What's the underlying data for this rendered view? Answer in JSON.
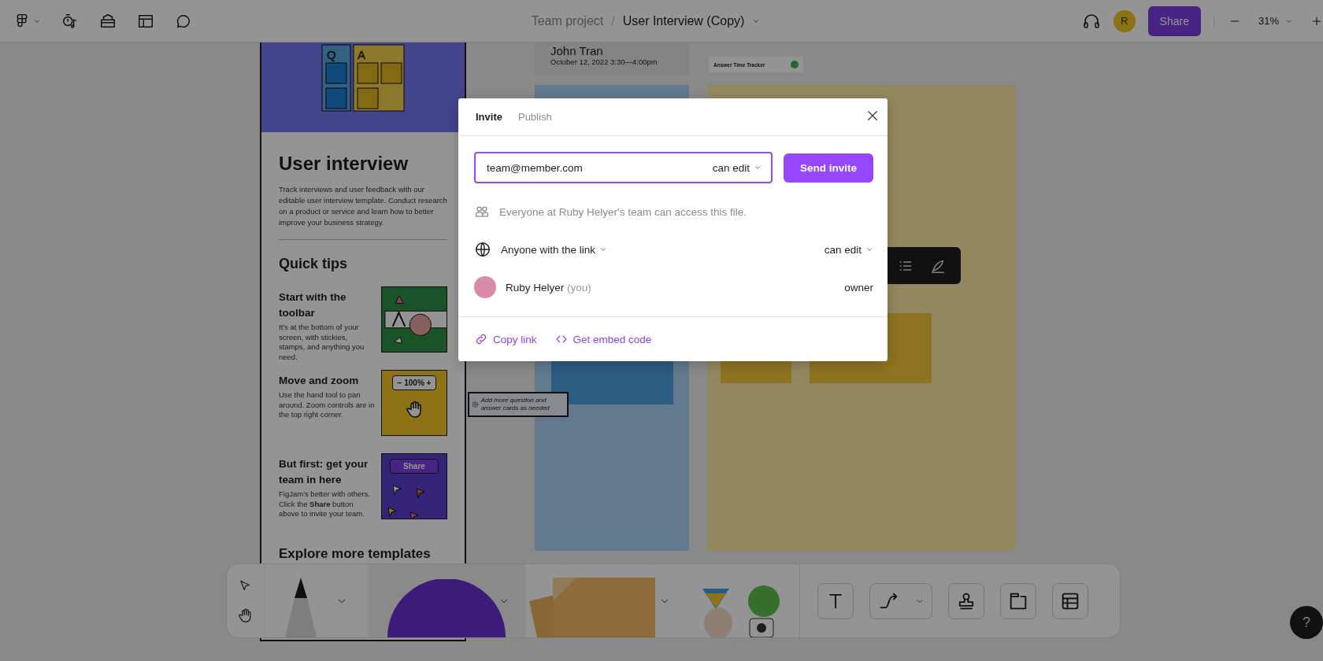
{
  "top_bar": {
    "project": "Team project",
    "separator": "/",
    "file_title": "User Interview (Copy)",
    "avatar_initial": "R",
    "share_button": "Share",
    "zoom": "31%"
  },
  "template_panel": {
    "qa_letters": [
      "Q",
      "A"
    ],
    "title": "User interview",
    "description": "Track interviews and user feedback with our editable user interview template. Conduct research on a product or service and learn how to better improve your business strategy.",
    "section_title": "Quick tips",
    "tips": [
      {
        "kind": "toolbar",
        "title": "Start with the toolbar",
        "body": "It's at the bottom of your screen, with stickies, stamps, and anything you need."
      },
      {
        "kind": "zoom",
        "title": "Move and zoom",
        "body": "Use the hand tool to pan around. Zoom controls are in the top right corner.",
        "badge": "− 100% +"
      },
      {
        "kind": "share",
        "title": "But first: get your team in here",
        "body": "FigJam's better with others. Click the **Share** button above to invite your team.",
        "badge": "Share"
      }
    ],
    "footer_title": "Explore more templates"
  },
  "canvas": {
    "interview_card": {
      "name": "John Tran",
      "date": "October 12, 2022 3:30—4:00pm"
    },
    "tracker_label": "Answer Time Tracker",
    "note": "Add more question and answer cards as needed"
  },
  "dialog": {
    "tabs": [
      {
        "label": "Invite",
        "selected": true
      },
      {
        "label": "Publish",
        "selected": false
      }
    ],
    "email": {
      "value": "team@member.com",
      "permission": "can edit"
    },
    "send_button": "Send invite",
    "team_notice": "Everyone at Ruby Helyer's team can access this file.",
    "link_access": {
      "label": "Anyone with the link",
      "permission": "can edit"
    },
    "members": [
      {
        "name": "Ruby Helyer",
        "suffix": "(you)",
        "role": "owner"
      }
    ],
    "footer_links": [
      {
        "kind": "copy",
        "label": "Copy link"
      },
      {
        "kind": "embed",
        "label": "Get embed code"
      }
    ]
  },
  "help_button": "?"
}
